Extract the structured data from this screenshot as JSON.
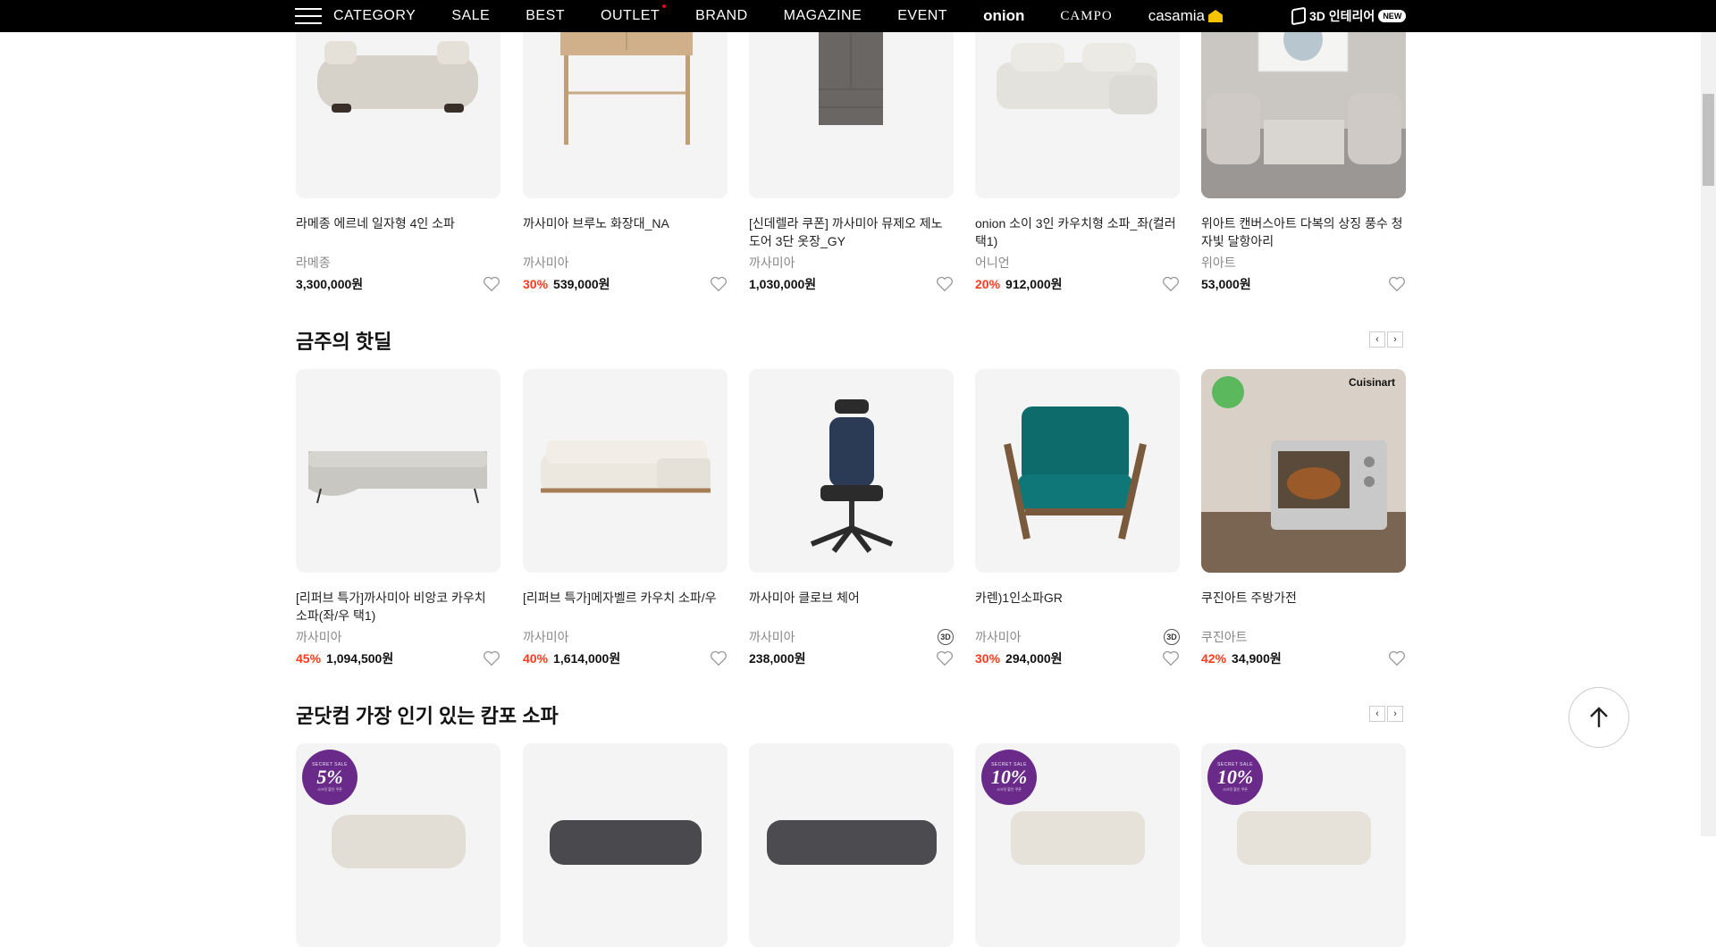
{
  "nav": {
    "items": [
      "CATEGORY",
      "SALE",
      "BEST",
      "OUTLET",
      "BRAND",
      "MAGAZINE",
      "EVENT"
    ],
    "brands": [
      "onion",
      "CAMPO",
      "casamia"
    ],
    "interior3d": "3D 인테리어",
    "new_badge": "NEW",
    "menu_icon": "hamburger-icon"
  },
  "row1": [
    {
      "name": "라메종 에르네 일자형 4인 소파",
      "brand": "라메종",
      "discount": "",
      "price": "3,300,000원"
    },
    {
      "name": "까사미아 브루노 화장대_NA",
      "brand": "까사미아",
      "discount": "30%",
      "price": "539,000원"
    },
    {
      "name": "[신데렐라 쿠폰] 까사미아 뮤제오 제노 도어 3단 옷장_GY",
      "brand": "까사미아",
      "discount": "",
      "price": "1,030,000원"
    },
    {
      "name": "onion 소이 3인 카우치형 소파_좌(컬러 택1)",
      "brand": "어니언",
      "discount": "20%",
      "price": "912,000원"
    },
    {
      "name": "위아트 캔버스아트 다복의 상징 풍수 청자빛 달항아리",
      "brand": "위아트",
      "discount": "",
      "price": "53,000원"
    }
  ],
  "section2": {
    "title": "금주의 핫딜",
    "prev": "‹",
    "next": "›",
    "items": [
      {
        "name": "[리퍼브 특가]까사미아 비앙코 카우치 소파(좌/우 택1)",
        "brand": "까사미아",
        "discount": "45%",
        "price": "1,094,500원",
        "badge3d": ""
      },
      {
        "name": "[리퍼브 특가]메자벨르 카우치 소파/우",
        "brand": "까사미아",
        "discount": "40%",
        "price": "1,614,000원",
        "badge3d": ""
      },
      {
        "name": "까사미아 클로브 체어",
        "brand": "까사미아",
        "discount": "",
        "price": "238,000원",
        "badge3d": "3D"
      },
      {
        "name": "카렌)1인소파GR",
        "brand": "까사미아",
        "discount": "30%",
        "price": "294,000원",
        "badge3d": "3D"
      },
      {
        "name": "쿠진아트 주방가전",
        "brand": "쿠진아트",
        "discount": "42%",
        "price": "34,900원",
        "badge3d": ""
      }
    ],
    "cuisinart_logo": "Cuisinart"
  },
  "section3": {
    "title": "굳닷컴 가장 인기 있는 캄포 소파",
    "prev": "‹",
    "next": "›",
    "badges": [
      {
        "top": "SECRET SALE",
        "mid": "5%",
        "bot": "시크릿 할인 쿠폰"
      },
      {
        "top": "",
        "mid": "",
        "bot": ""
      },
      {
        "top": "",
        "mid": "",
        "bot": ""
      },
      {
        "top": "SECRET SALE",
        "mid": "10%",
        "bot": "시크릿 할인 쿠폰"
      },
      {
        "top": "SECRET SALE",
        "mid": "10%",
        "bot": "시크릿 할인 쿠폰"
      }
    ]
  },
  "colors": {
    "accent_discount": "#ff3b1f",
    "nav_bg": "#000000",
    "sale_badge": "#6a2a8a"
  }
}
